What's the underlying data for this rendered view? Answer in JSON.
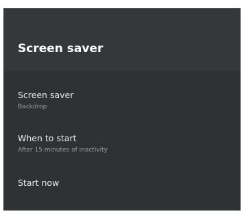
{
  "header": {
    "title": "Screen saver"
  },
  "items": [
    {
      "title": "Screen saver",
      "subtitle": "Backdrop"
    },
    {
      "title": "When to start",
      "subtitle": "After 15 minutes of inactivity"
    },
    {
      "title": "Start now"
    }
  ],
  "colors": {
    "panel_background": "#33373a",
    "body_background": "#2f3235",
    "title_text": "#ffffff",
    "item_text": "#e9eaeb",
    "subtitle_text": "#9a9d9f"
  }
}
